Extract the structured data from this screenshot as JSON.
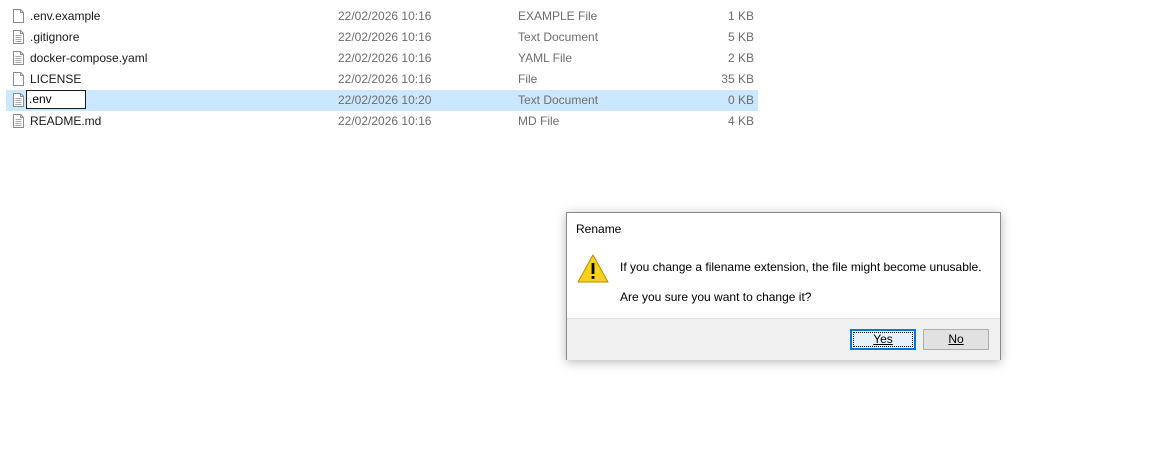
{
  "files": [
    {
      "name": ".env.example",
      "date": "22/02/2026 10:16",
      "type": "EXAMPLE File",
      "size": "1 KB",
      "icon": "file-icon"
    },
    {
      "name": ".gitignore",
      "date": "22/02/2026 10:16",
      "type": "Text Document",
      "size": "5 KB",
      "icon": "text-file-icon"
    },
    {
      "name": "docker-compose.yaml",
      "date": "22/02/2026 10:16",
      "type": "YAML File",
      "size": "2 KB",
      "icon": "text-file-icon"
    },
    {
      "name": "LICENSE",
      "date": "22/02/2026 10:16",
      "type": "File",
      "size": "35 KB",
      "icon": "file-icon"
    },
    {
      "name": ".env",
      "date": "22/02/2026 10:20",
      "type": "Text Document",
      "size": "0 KB",
      "icon": "text-file-icon",
      "selected": true,
      "renaming": true
    },
    {
      "name": "README.md",
      "date": "22/02/2026 10:16",
      "type": "MD File",
      "size": "4 KB",
      "icon": "text-file-icon"
    }
  ],
  "dialog": {
    "title": "Rename",
    "message": "If you change a filename extension, the file might become unusable.",
    "question": "Are you sure you want to change it?",
    "yes_label": "Yes",
    "no_label": "No",
    "icon": "warning-icon"
  },
  "colors": {
    "selection": "#cce8ff",
    "secondary_text": "#6d6d6d",
    "accent": "#0078d7",
    "warning": "#f7d21c"
  }
}
